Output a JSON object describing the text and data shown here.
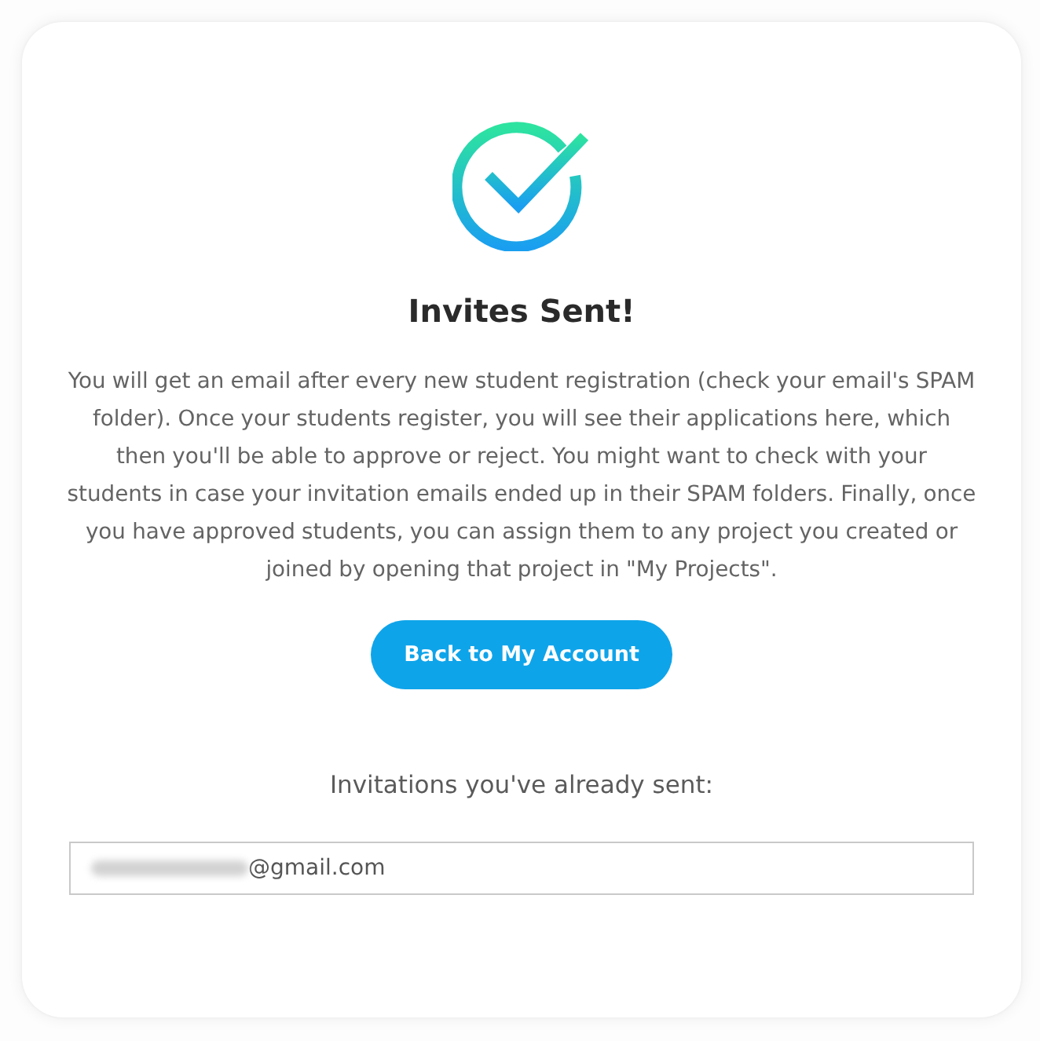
{
  "title": "Invites Sent!",
  "message": "You will get an email after every new student registration (check your email's SPAM folder). Once your students register, you will see their applications here, which then you'll be able to approve or reject. You might want to check with your students in case your invitation emails ended up in their SPAM folders. Finally, once you have approved students, you can assign them to any project you created or joined by opening that project in \"My Projects\".",
  "button": {
    "label": "Back to My Account"
  },
  "invitations": {
    "heading": "Invitations you've already sent:",
    "items": [
      {
        "value": "@gmail.com",
        "redacted": true
      }
    ]
  }
}
